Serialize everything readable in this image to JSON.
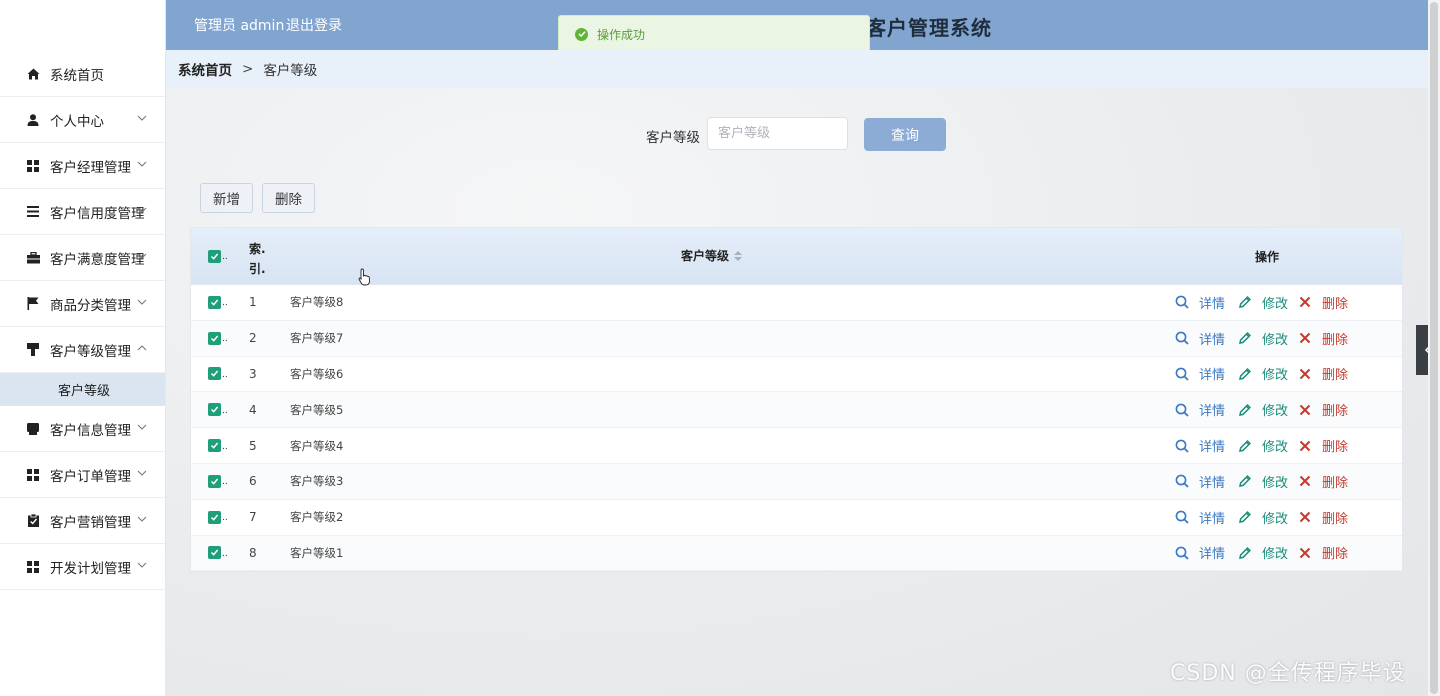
{
  "header": {
    "admin_text": "管理员 admin",
    "logout": "退出登录",
    "title": "客户管理系统"
  },
  "toast": {
    "message": "操作成功"
  },
  "breadcrumb": {
    "home": "系统首页",
    "separator": ">",
    "current": "客户等级"
  },
  "sidebar": {
    "items": [
      {
        "label": "系统首页",
        "icon": "home-icon"
      },
      {
        "label": "个人中心",
        "icon": "user-icon"
      },
      {
        "label": "客户经理管理",
        "icon": "grid-icon"
      },
      {
        "label": "客户信用度管理",
        "icon": "list-icon"
      },
      {
        "label": "客户满意度管理",
        "icon": "briefcase-icon"
      },
      {
        "label": "商品分类管理",
        "icon": "flag-icon"
      },
      {
        "label": "客户等级管理",
        "icon": "stamp-icon"
      },
      {
        "label": "客户信息管理",
        "icon": "box-icon"
      },
      {
        "label": "客户订单管理",
        "icon": "grid-icon"
      },
      {
        "label": "客户营销管理",
        "icon": "clipboard-icon"
      },
      {
        "label": "开发计划管理",
        "icon": "grid-icon"
      }
    ],
    "active_sub": "客户等级"
  },
  "search": {
    "label": "客户等级",
    "placeholder": "客户等级",
    "value": "",
    "button": "查询"
  },
  "actions": {
    "add": "新增",
    "delete": "删除"
  },
  "table": {
    "headers": {
      "index": "索.\n引.",
      "level": "客户等级",
      "operation": "操作"
    },
    "checkbox_dots": "..",
    "rows": [
      {
        "index": "1",
        "level": "客户等级8"
      },
      {
        "index": "2",
        "level": "客户等级7"
      },
      {
        "index": "3",
        "level": "客户等级6"
      },
      {
        "index": "4",
        "level": "客户等级5"
      },
      {
        "index": "5",
        "level": "客户等级4"
      },
      {
        "index": "6",
        "level": "客户等级3"
      },
      {
        "index": "7",
        "level": "客户等级2"
      },
      {
        "index": "8",
        "level": "客户等级1"
      }
    ],
    "ops": {
      "detail": "详情",
      "edit": "修改",
      "delete": "删除"
    }
  },
  "watermark": "CSDN @全传程序毕设",
  "colors": {
    "header": "#82a5d0",
    "accent": "#1f9f79",
    "detail": "#3b78c2",
    "edit": "#1a8c7a",
    "delete": "#c33b2e"
  }
}
